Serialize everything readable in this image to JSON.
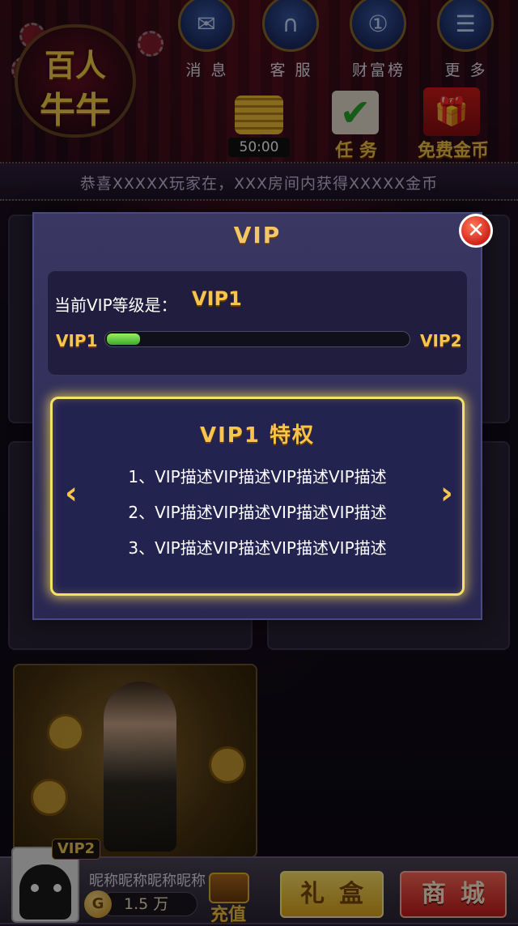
{
  "header": {
    "logo": {
      "line1": "百人",
      "line2": "牛牛"
    },
    "buttons": [
      {
        "label": "消 息",
        "icon": "mail-icon"
      },
      {
        "label": "客 服",
        "icon": "headset-icon"
      },
      {
        "label": "财富榜",
        "icon": "medal-icon"
      },
      {
        "label": "更 多",
        "icon": "menu-icon"
      }
    ],
    "timer": "50:00",
    "task_label": "任 务",
    "free_coins_label": "免费金币"
  },
  "marquee": "恭喜XXXXX玩家在，XXX房间内获得XXXXX金币",
  "vip_dialog": {
    "title": "VIP",
    "current_level_label": "当前VIP等级是：",
    "current_level": "VIP1",
    "progress": {
      "from": "VIP1",
      "to": "VIP2",
      "value": 0.11
    },
    "privilege": {
      "title": "VIP1 特权",
      "items": [
        "1、VIP描述VIP描述VIP描述VIP描述",
        "2、VIP描述VIP描述VIP描述VIP描述",
        "3、VIP描述VIP描述VIP描述VIP描述"
      ]
    },
    "colors": {
      "accent": "#f7c44d",
      "progress": "#5cd03a",
      "close": "#d0221a"
    }
  },
  "footer": {
    "vip_badge": "VIP2",
    "nickname": "昵称昵称昵称昵称",
    "coins": "1.5 万",
    "coin_symbol": "G",
    "recharge_label": "充值",
    "gift_label": "礼盒",
    "shop_label": "商城"
  }
}
